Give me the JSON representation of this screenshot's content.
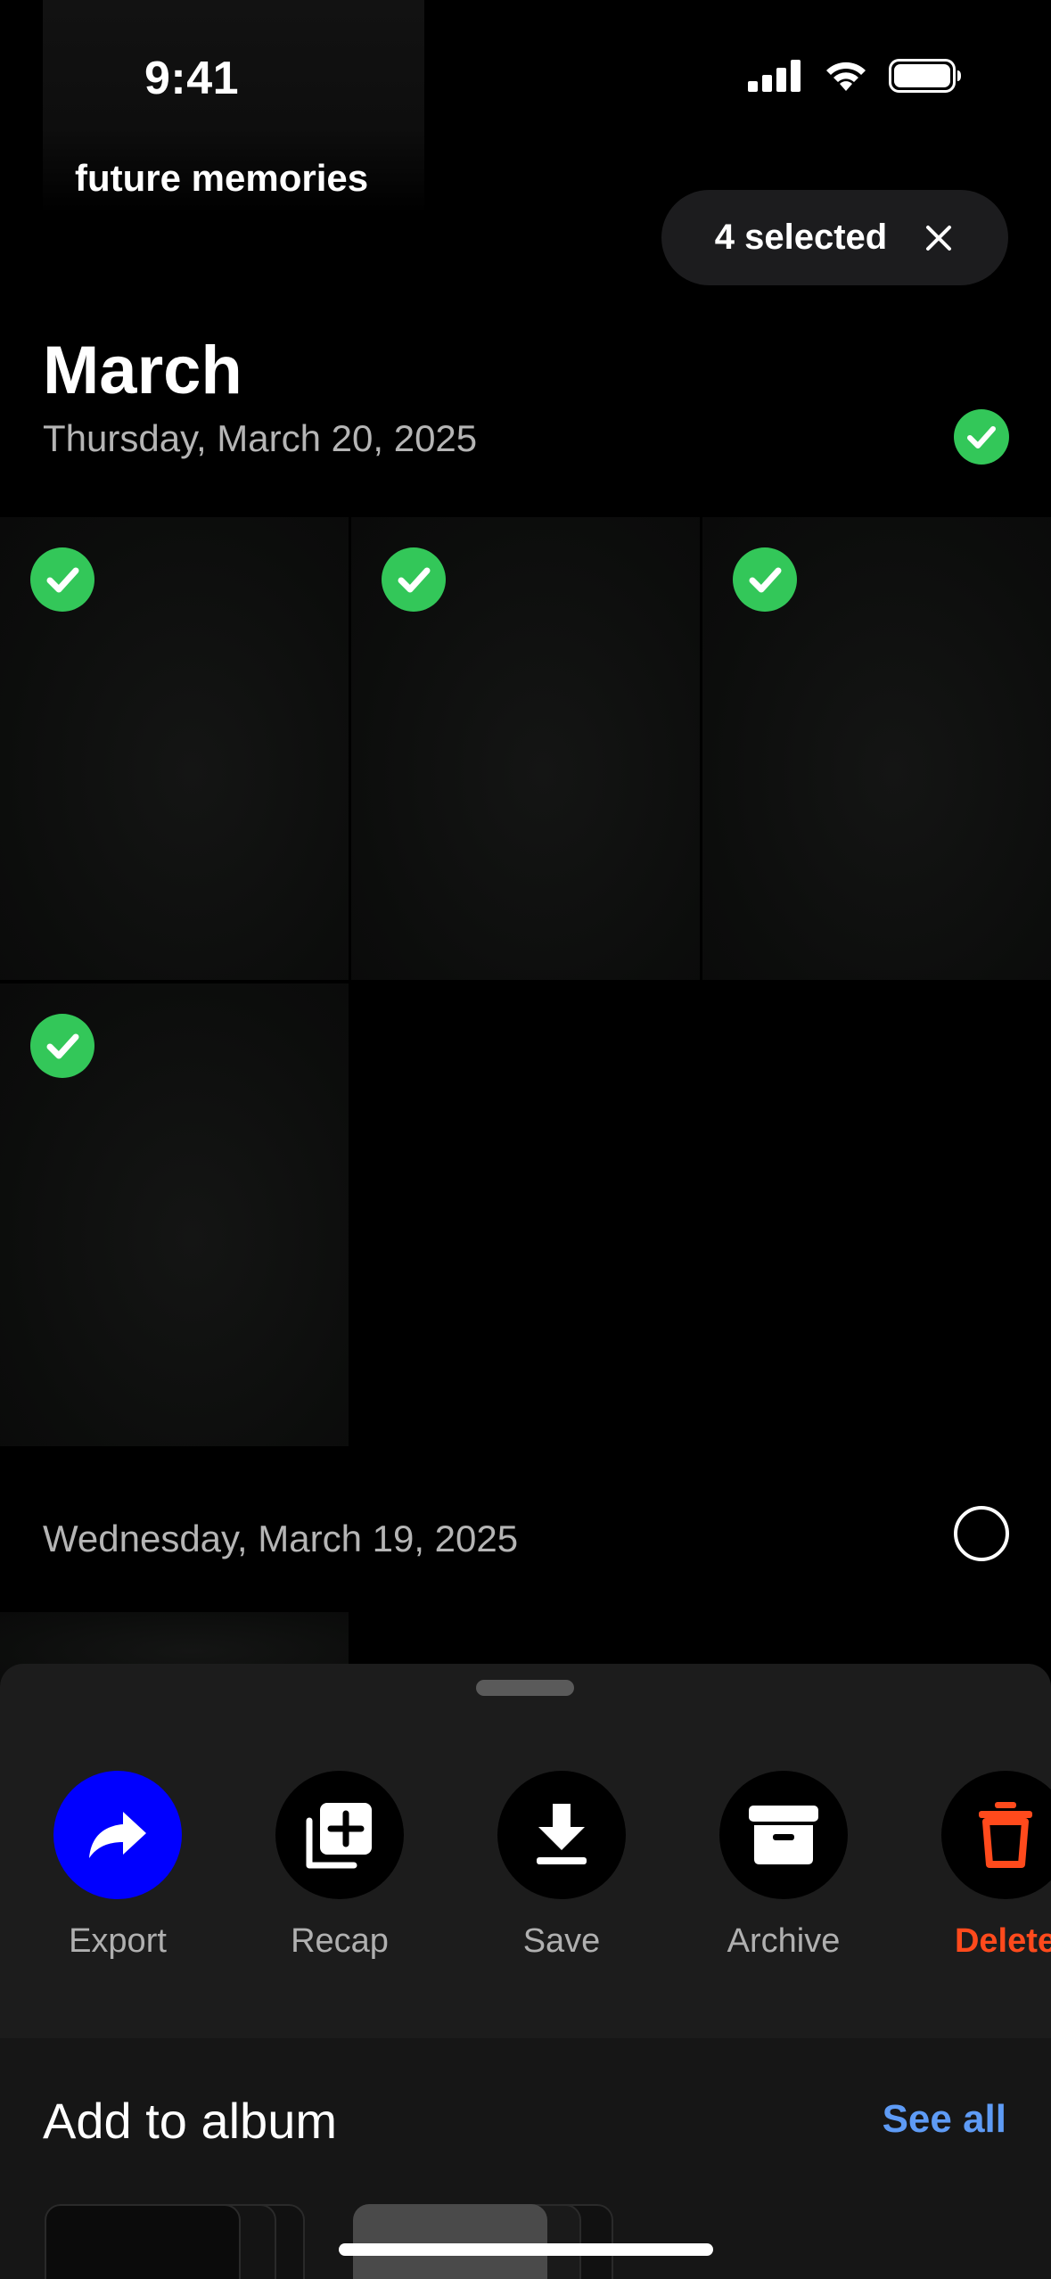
{
  "status_bar": {
    "time": "9:41"
  },
  "album": {
    "title": "future memories"
  },
  "selection": {
    "label": "4 selected"
  },
  "timeline": {
    "month": "March",
    "days": [
      {
        "label": "Thursday, March 20, 2025",
        "selected": true
      },
      {
        "label": "Wednesday, March 19, 2025",
        "selected": false
      }
    ]
  },
  "photos": [
    {
      "selected": true
    },
    {
      "selected": true
    },
    {
      "selected": true
    },
    {
      "selected": true
    }
  ],
  "actions": [
    {
      "label": "Export",
      "icon": "share-arrow-icon"
    },
    {
      "label": "Recap",
      "icon": "add-to-stack-icon"
    },
    {
      "label": "Save",
      "icon": "download-icon"
    },
    {
      "label": "Archive",
      "icon": "archive-box-icon"
    },
    {
      "label": "Delete",
      "icon": "trash-icon"
    }
  ],
  "add_to_album": {
    "title": "Add to album",
    "see_all": "See all"
  },
  "colors": {
    "accent_blue": "#0000ff",
    "check_green": "#33c759",
    "delete_red": "#ff4a1c",
    "link_blue": "#5e9bf5"
  }
}
